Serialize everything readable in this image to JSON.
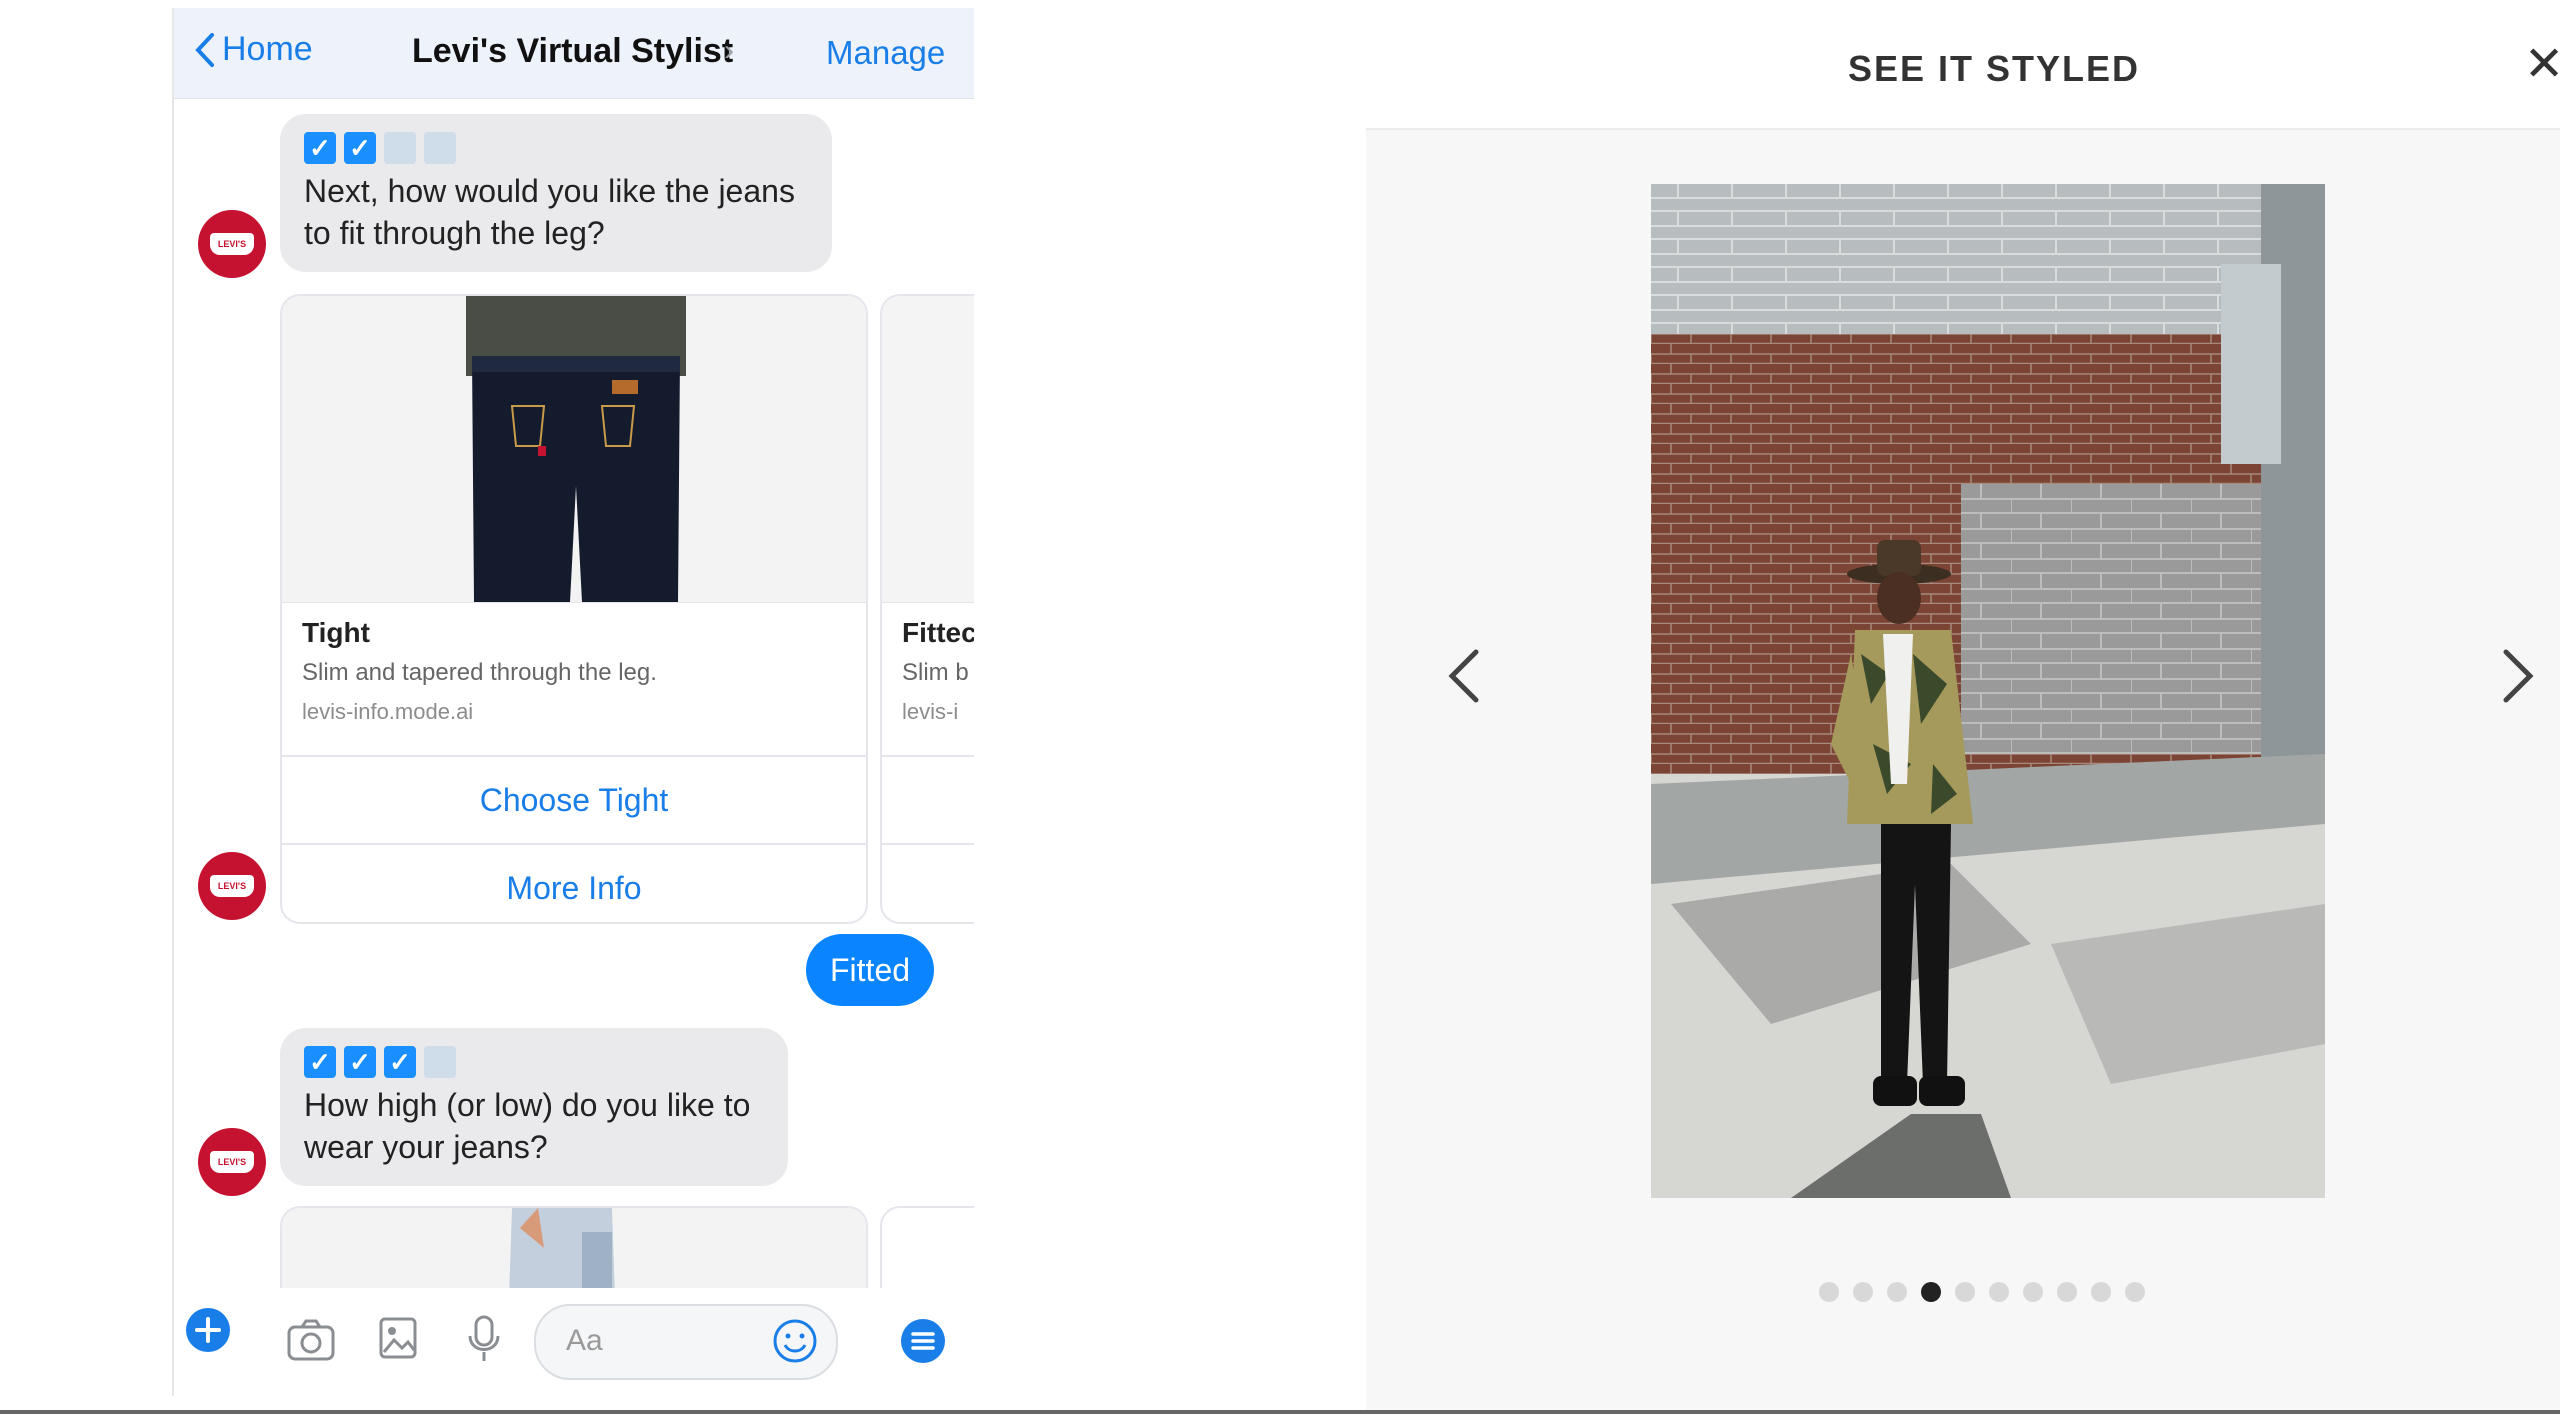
{
  "messenger": {
    "header": {
      "back_label": "Home",
      "title": "Levi's Virtual Stylist",
      "title_chevron": "›",
      "manage_label": "Manage"
    },
    "messages": [
      {
        "type": "bot",
        "text": "Next, how would you like the jeans to fit through the leg?",
        "progress": {
          "checked": 2,
          "total": 4
        }
      },
      {
        "type": "bot_carousel",
        "cards": [
          {
            "title": "Tight",
            "subtitle": "Slim and tapered through the leg.",
            "source": "levis-info.mode.ai",
            "buttons": [
              "Choose Tight",
              "More Info"
            ]
          },
          {
            "title": "Fittec",
            "subtitle": "Slim b",
            "source": "levis-i"
          }
        ]
      },
      {
        "type": "user",
        "text": "Fitted"
      },
      {
        "type": "bot",
        "text": "How high (or low) do you like to wear your jeans?",
        "progress": {
          "checked": 3,
          "total": 4
        }
      }
    ],
    "composer": {
      "placeholder": "Aa",
      "icons": [
        "plus-icon",
        "camera-icon",
        "image-icon",
        "microphone-icon",
        "emoji-icon",
        "menu-icon"
      ]
    },
    "colors": {
      "accent": "#1a7ee8",
      "user_bubble": "#0a84ff",
      "bot_bubble": "#eaeaec",
      "brand": "#c41230"
    }
  },
  "styled": {
    "title": "SEE IT STYLED",
    "close_label": "✕",
    "carousel": {
      "total": 10,
      "active_index": 3
    },
    "icons": [
      "chevron-left-icon",
      "chevron-right-icon"
    ]
  }
}
